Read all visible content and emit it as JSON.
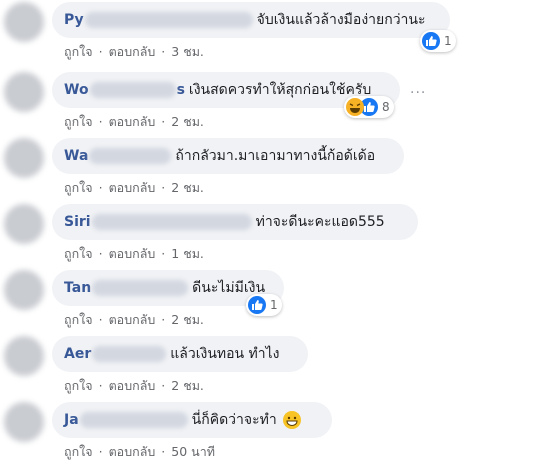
{
  "actions": {
    "like": "ถูกใจ",
    "reply": "ตอบกลับ",
    "dot": "·"
  },
  "more_icon": "more-horizontal-icon",
  "comments": [
    {
      "author_start": "Py",
      "author_end": "",
      "text": "จับเงินแล้วล้างมือง่ายกว่านะ",
      "time": "3 ชม.",
      "reactions": {
        "types": [
          "like"
        ],
        "count": "1"
      }
    },
    {
      "author_start": "Wo",
      "author_end": "s",
      "text": "เงินสดควรทำให้สุกก่อนใช้ครับ",
      "time": "2 ชม.",
      "reactions": {
        "types": [
          "haha",
          "like"
        ],
        "count": "8"
      }
    },
    {
      "author_start": "Wa",
      "author_end": "",
      "text": "ถ้ากลัวมา.มาเอามาทางนี้ก้อด้เด้อ",
      "time": "2 ชม."
    },
    {
      "author_start": "Siri",
      "author_end": "",
      "text": "ท่าจะดีนะคะแอด555",
      "time": "1 ชม."
    },
    {
      "author_start": "Tan",
      "author_end": "",
      "text": "ดีนะไม่มีเงิน",
      "time": "2 ชม.",
      "reactions": {
        "types": [
          "like"
        ],
        "count": "1"
      }
    },
    {
      "author_start": "Aer",
      "author_end": "",
      "text": "แล้วเงินทอน ทำไง",
      "time": "2 ชม."
    },
    {
      "author_start": "Ja",
      "author_end": "",
      "text": "นี่ก็คิดว่าจะทำ",
      "time": "50 นาที",
      "emoji": "grinning-face-icon"
    }
  ],
  "colors": {
    "author": "#385898",
    "bubble": "#f0f2f5",
    "like": "#1877f2",
    "meta": "#65676b"
  }
}
